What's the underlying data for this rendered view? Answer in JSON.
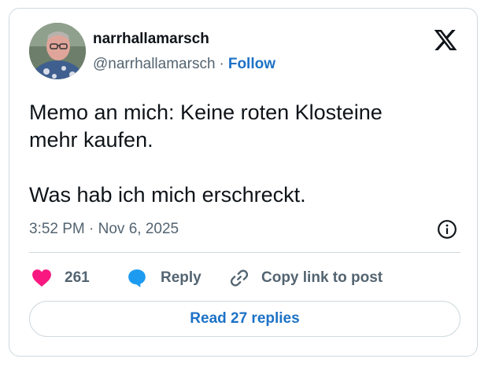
{
  "author": {
    "name": "narrhallamarsch",
    "handle": "@narrhallamarsch",
    "separator": "·",
    "follow_label": "Follow"
  },
  "tweet": {
    "text": "Memo an mich: Keine roten Klosteine\nmehr kaufen.\n\nWas hab ich mich erschreckt.",
    "timestamp": "3:52 PM · Nov 6, 2025"
  },
  "actions": {
    "like_count": "261",
    "reply_label": "Reply",
    "copy_label": "Copy link to post"
  },
  "read_replies_label": "Read 27 replies",
  "icons": {
    "logo": "x-logo-icon",
    "info": "info-icon",
    "like": "heart-icon",
    "reply": "speech-bubble-icon",
    "copy": "link-icon"
  },
  "colors": {
    "link": "#1d72c6",
    "heart": "#f91880",
    "reply_bubble": "#1d9bf0",
    "muted": "#536471",
    "border": "#cfd9de"
  }
}
